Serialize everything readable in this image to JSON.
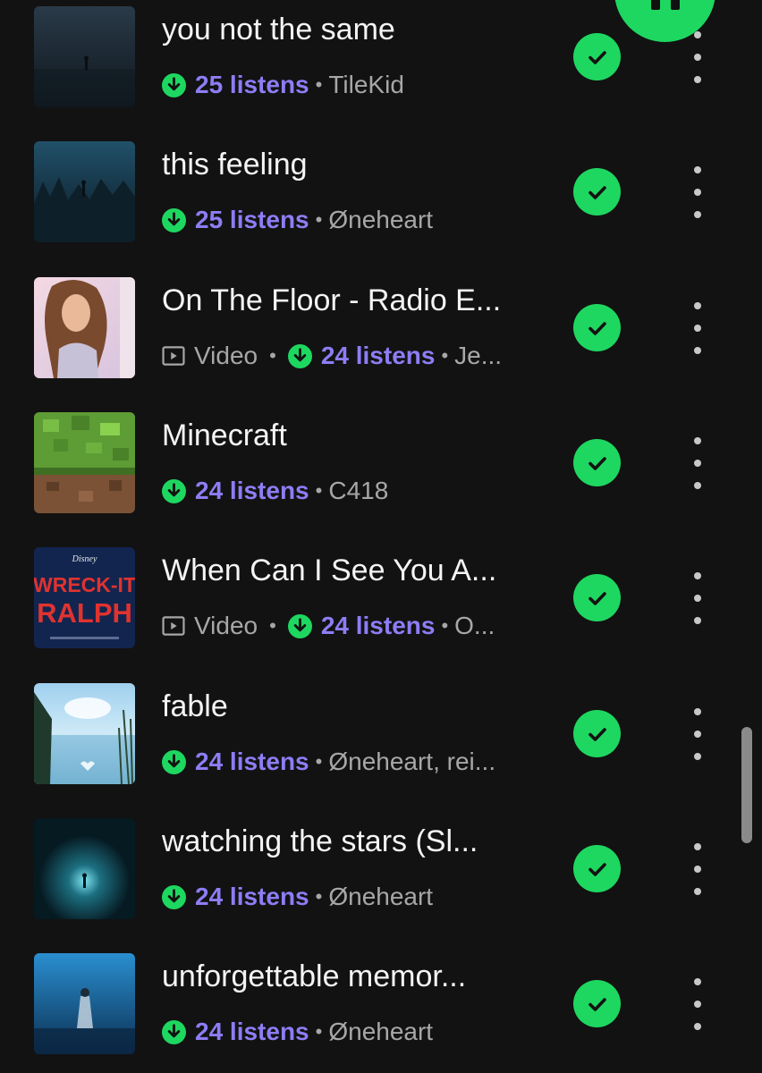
{
  "tracks": [
    {
      "title": "you not the same",
      "video_label": "",
      "listens": "25 listens",
      "artist": "TileKid",
      "cover": "fog-figure"
    },
    {
      "title": "this feeling",
      "video_label": "",
      "listens": "25 listens",
      "artist": "Øneheart",
      "cover": "dark-forest"
    },
    {
      "title": "On The Floor - Radio E...",
      "video_label": "Video",
      "listens": "24 listens",
      "artist": "Je...",
      "cover": "portrait"
    },
    {
      "title": "Minecraft",
      "video_label": "",
      "listens": "24 listens",
      "artist": "C418",
      "cover": "grass-block"
    },
    {
      "title": "When Can I See You A...",
      "video_label": "Video",
      "listens": "24 listens",
      "artist": "O...",
      "cover": "wreck-it-ralph",
      "cover_text": {
        "brand": "Disney",
        "line1": "WRECK-IT",
        "line2": "RALPH"
      }
    },
    {
      "title": "fable",
      "video_label": "",
      "listens": "24 listens",
      "artist": "Øneheart, rei...",
      "cover": "lake"
    },
    {
      "title": "watching the stars (Sl...",
      "video_label": "",
      "listens": "24 listens",
      "artist": "Øneheart",
      "cover": "glow-figure"
    },
    {
      "title": "unforgettable memor...",
      "video_label": "",
      "listens": "24 listens",
      "artist": "Øneheart",
      "cover": "blue-figure"
    }
  ],
  "colors": {
    "accent": "#1ed760",
    "listens": "#8d7df5",
    "background": "#121212"
  },
  "icons": {
    "downloaded": "download-arrow-icon",
    "saved": "check-icon",
    "menu": "more-vertical-icon",
    "video": "video-play-icon",
    "player": "pause-icon"
  }
}
